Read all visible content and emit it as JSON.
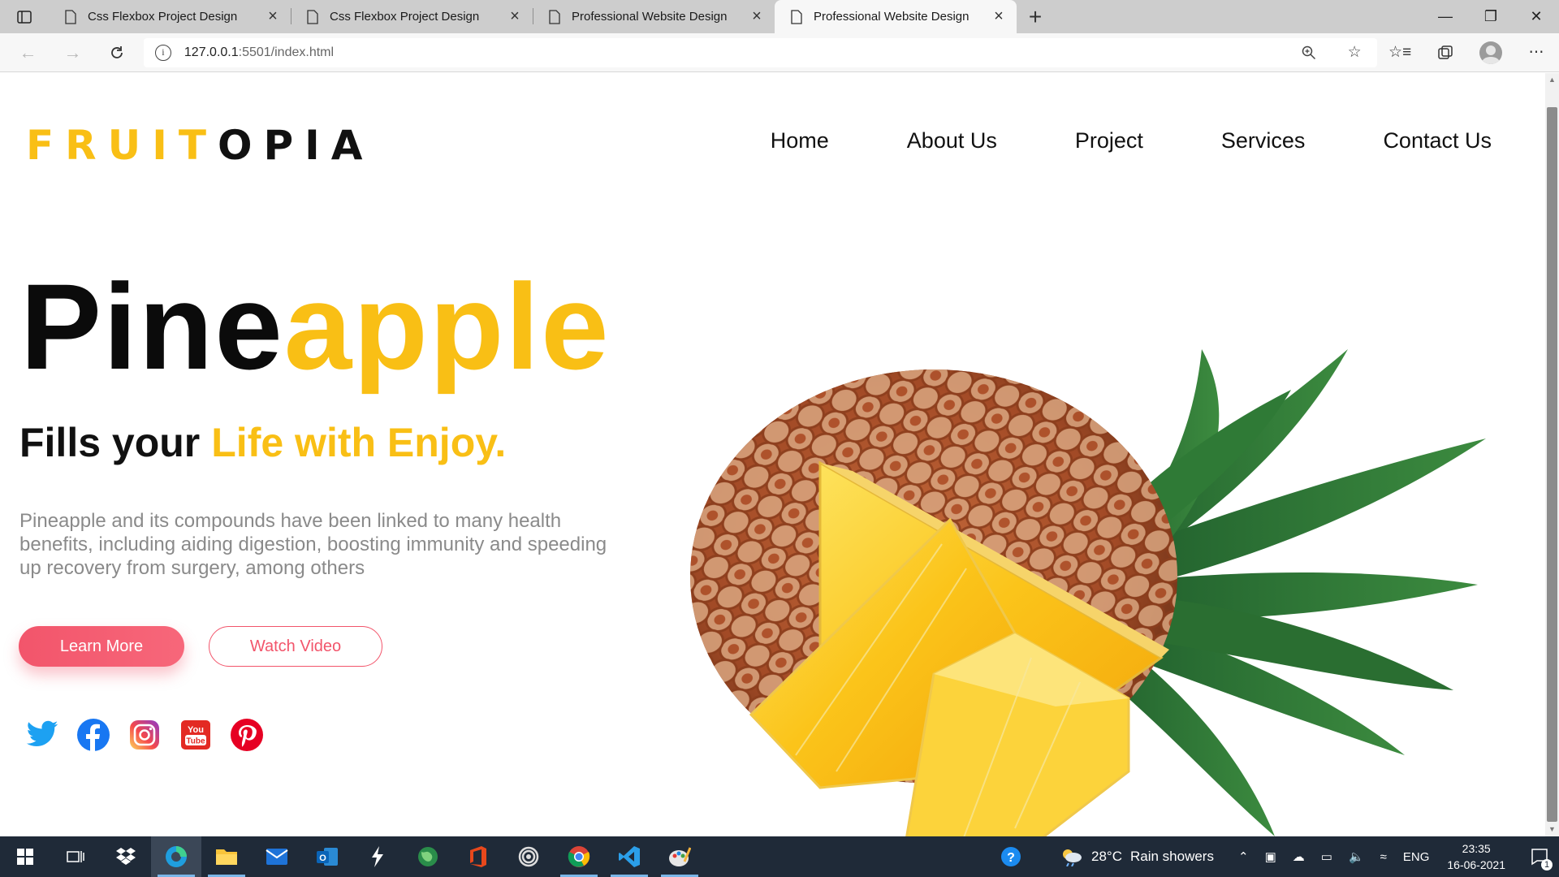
{
  "browser": {
    "tabs": [
      {
        "title": "Css Flexbox Project Design",
        "active": false
      },
      {
        "title": "Css Flexbox Project Design",
        "active": false
      },
      {
        "title": "Professional Website Design",
        "active": false
      },
      {
        "title": "Professional Website Design",
        "active": true
      }
    ],
    "url_host": "127.0.0.1",
    "url_rest": ":5501/index.html"
  },
  "site": {
    "logo_part1": "FRUIT",
    "logo_part2": "OPIA",
    "nav": [
      "Home",
      "About Us",
      "Project",
      "Services",
      "Contact Us"
    ],
    "hero": {
      "title_dark": "Pine",
      "title_gold": "apple",
      "sub_dark": "Fills your",
      "sub_gold": "Life with Enjoy.",
      "description": "Pineapple and its compounds have been linked to many health benefits, including aiding digestion, boosting immunity and speeding up recovery from surgery, among others",
      "primary_button": "Learn More",
      "secondary_button": "Watch Video"
    },
    "social_icons": [
      "twitter-icon",
      "facebook-icon",
      "instagram-icon",
      "youtube-icon",
      "pinterest-icon"
    ],
    "colors": {
      "accent_gold": "#f9bf15",
      "accent_pink": "#f2556b",
      "text_dark": "#111111",
      "text_muted": "#8a8a8a"
    }
  },
  "taskbar": {
    "weather_temp": "28°C",
    "weather_desc": "Rain showers",
    "language": "ENG",
    "time": "23:35",
    "date": "16-06-2021",
    "notification_count": "1"
  }
}
